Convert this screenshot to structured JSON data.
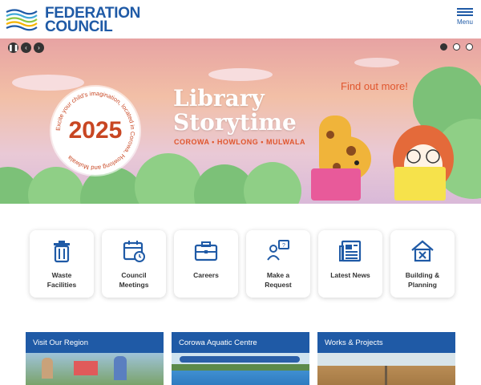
{
  "header": {
    "logo_line1": "FEDERATION",
    "logo_line2": "COUNCIL",
    "menu_label": "Menu",
    "brand_color": "#1f5aa6"
  },
  "hero": {
    "controls": [
      {
        "name": "pause",
        "glyph": "❚❚"
      },
      {
        "name": "prev",
        "glyph": "‹"
      },
      {
        "name": "next",
        "glyph": "›"
      }
    ],
    "slide_count": 3,
    "active_slide": 1,
    "badge_year": "2025",
    "badge_ring_text": "Excite your child's imagination, located in Corowa, Howlong and Mulwala",
    "title": "Library Storytime",
    "subtitle": "COROWA • HOWLONG • MULWALA",
    "cta": "Find out more!",
    "accent_color": "#e0562e"
  },
  "quick_links": [
    {
      "label_line1": "Waste",
      "label_line2": "Facilities",
      "icon": "waste-bin-icon"
    },
    {
      "label_line1": "Council",
      "label_line2": "Meetings",
      "icon": "calendar-clock-icon"
    },
    {
      "label_line1": "Careers",
      "label_line2": "",
      "icon": "briefcase-icon"
    },
    {
      "label_line1": "Make a",
      "label_line2": "Request",
      "icon": "request-icon"
    },
    {
      "label_line1": "Latest News",
      "label_line2": "",
      "icon": "newspaper-icon"
    },
    {
      "label_line1": "Building &",
      "label_line2": "Planning",
      "icon": "house-tools-icon"
    }
  ],
  "cards": [
    {
      "title": "Visit Our Region"
    },
    {
      "title": "Corowa Aquatic Centre"
    },
    {
      "title": "Works & Projects"
    }
  ]
}
